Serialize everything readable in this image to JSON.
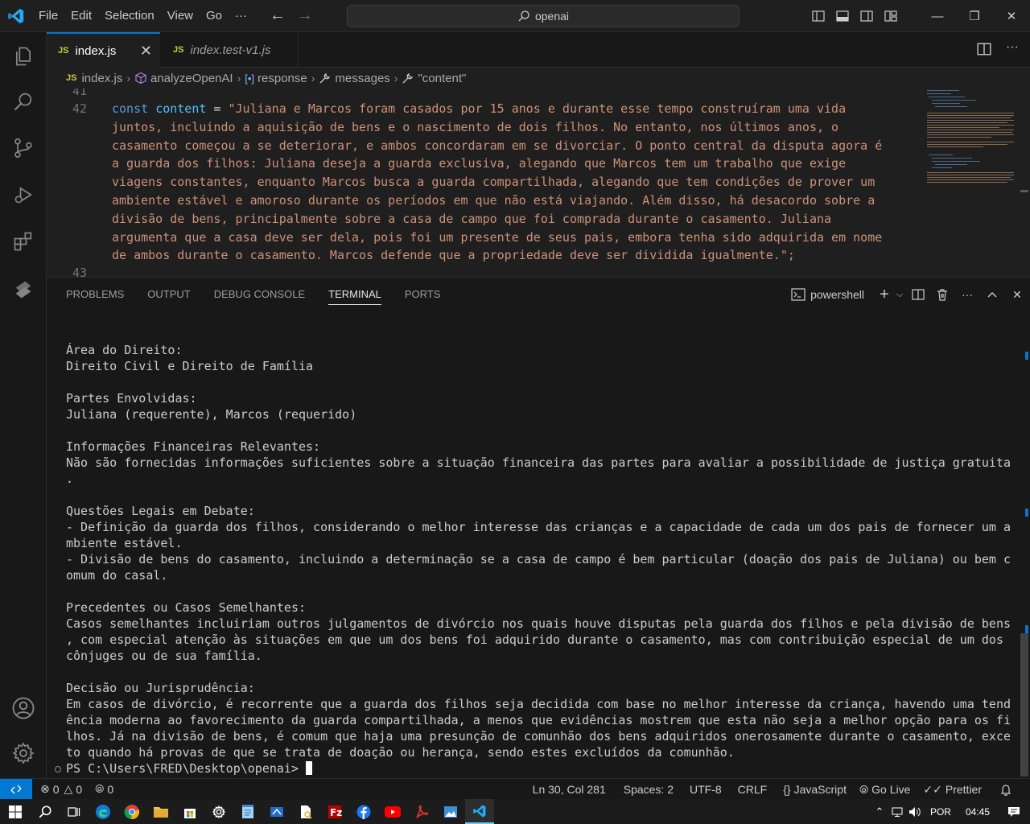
{
  "titlebar": {
    "menu": [
      "File",
      "Edit",
      "Selection",
      "View",
      "Go",
      "···"
    ],
    "search_text": "openai"
  },
  "tabs": [
    {
      "label": "index.js",
      "badge": "JS"
    },
    {
      "label": "index.test-v1.js",
      "badge": "JS"
    }
  ],
  "breadcrumb": [
    "index.js",
    "analyzeOpenAI",
    "response",
    "messages",
    "\"content\""
  ],
  "editor": {
    "line_prev": "41",
    "line_num": "42",
    "line_next": "43",
    "keyword": "const",
    "variable": "content",
    "operator": " = ",
    "string_lines": [
      "\"Juliana e Marcos foram casados por 15 anos e durante esse tempo construíram uma vida",
      "juntos, incluindo a aquisição de bens e o nascimento de dois filhos. No entanto, nos últimos anos, o",
      "casamento começou a se deteriorar, e ambos concordaram em se divorciar. O ponto central da disputa agora é",
      "a guarda dos filhos: Juliana deseja a guarda exclusiva, alegando que Marcos tem um trabalho que exige",
      "viagens constantes, enquanto Marcos busca a guarda compartilhada, alegando que tem condições de prover um",
      "ambiente estável e amoroso durante os períodos em que não está viajando. Além disso, há desacordo sobre a",
      "divisão de bens, principalmente sobre a casa de campo que foi comprada durante o casamento. Juliana",
      "argumenta que a casa deve ser dela, pois foi um presente de seus pais, embora tenha sido adquirida em nome",
      "de ambos durante o casamento. Marcos defende que a propriedade deve ser dividida igualmente.\";"
    ]
  },
  "panel": {
    "tabs": [
      "PROBLEMS",
      "OUTPUT",
      "DEBUG CONSOLE",
      "TERMINAL",
      "PORTS"
    ],
    "active_tab": "TERMINAL",
    "shell_label": "powershell"
  },
  "terminal": {
    "lines": [
      "Área do Direito:",
      "Direito Civil e Direito de Família",
      "",
      "Partes Envolvidas:",
      "Juliana (requerente), Marcos (requerido)",
      "",
      "Informações Financeiras Relevantes:",
      "Não são fornecidas informações suficientes sobre a situação financeira das partes para avaliar a possibilidade de justiça gratuita",
      ".",
      "",
      "Questões Legais em Debate:",
      "- Definição da guarda dos filhos, considerando o melhor interesse das crianças e a capacidade de cada um dos pais de fornecer um a",
      "mbiente estável.",
      "- Divisão de bens do casamento, incluindo a determinação se a casa de campo é bem particular (doação dos pais de Juliana) ou bem c",
      "omum do casal.",
      "",
      "Precedentes ou Casos Semelhantes:",
      "Casos semelhantes incluiriam outros julgamentos de divórcio nos quais houve disputas pela guarda dos filhos e pela divisão de bens",
      ", com especial atenção às situações em que um dos bens foi adquirido durante o casamento, mas com contribuição especial de um dos",
      "cônjuges ou de sua família.",
      "",
      "Decisão ou Jurisprudência:",
      "Em casos de divórcio, é recorrente que a guarda dos filhos seja decidida com base no melhor interesse da criança, havendo uma tend",
      "ência moderna ao favorecimento da guarda compartilhada, a menos que evidências mostrem que esta não seja a melhor opção para os fi",
      "lhos. Já na divisão de bens, é comum que haja uma presunção de comunhão dos bens adquiridos onerosamente durante o casamento, exce",
      "to quando há provas de que se trata de doação ou herança, sendo estes excluídos da comunhão."
    ],
    "prompt": "PS C:\\Users\\FRED\\Desktop\\openai> "
  },
  "statusbar": {
    "errors": "0",
    "warnings": "0",
    "ports": "0",
    "position": "Ln 30, Col 281",
    "spaces": "Spaces: 2",
    "encoding": "UTF-8",
    "eol": "CRLF",
    "language": "JavaScript",
    "golive": "Go Live",
    "prettier": "Prettier"
  },
  "taskbar": {
    "lang": "POR",
    "time": "04:45"
  },
  "colors": {
    "accent": "#0078d4",
    "string": "#ce9178",
    "keyword": "#569cd6",
    "variable": "#4fc1ff"
  }
}
